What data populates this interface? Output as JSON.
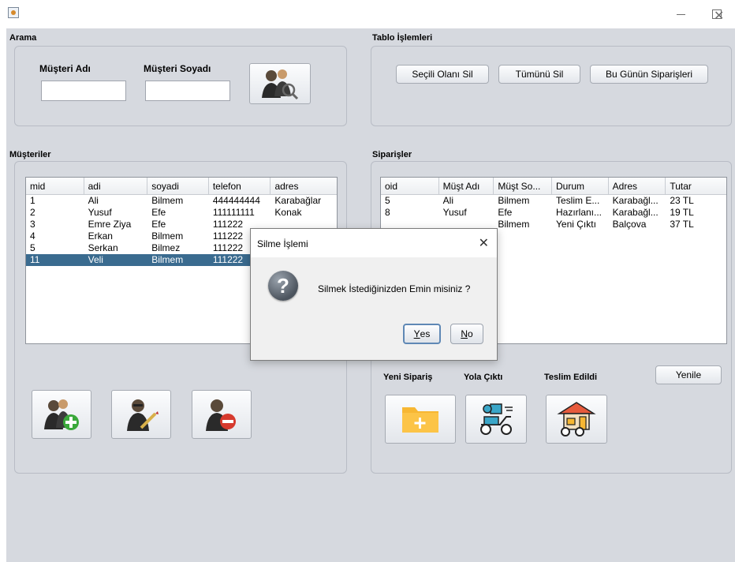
{
  "window": {
    "title": ""
  },
  "search": {
    "title": "Arama",
    "first_name_label": "Müşteri Adı",
    "last_name_label": "Müşteri Soyadı",
    "first_name_value": "",
    "last_name_value": ""
  },
  "table_ops": {
    "title": "Tablo İşlemleri",
    "delete_selected": "Seçili Olanı Sil",
    "delete_all": "Tümünü Sil",
    "today_orders": "Bu Günün Siparişleri"
  },
  "customers": {
    "title": "Müşteriler",
    "columns": [
      "mid",
      "adi",
      "soyadi",
      "telefon",
      "adres"
    ],
    "rows": [
      [
        "1",
        "Ali",
        "Bilmem",
        "444444444",
        "Karabağlar"
      ],
      [
        "2",
        "Yusuf",
        "Efe",
        "111111111",
        "Konak"
      ],
      [
        "3",
        "Emre Ziya",
        "Efe",
        "111222",
        ""
      ],
      [
        "4",
        "Erkan",
        "Bilmem",
        "111222",
        ""
      ],
      [
        "5",
        "Serkan",
        "Bilmez",
        "111222",
        ""
      ],
      [
        "11",
        "Veli",
        "Bilmem",
        "111222",
        ""
      ]
    ],
    "selected_row_index": 5
  },
  "orders": {
    "title": "Siparişler",
    "columns": [
      "oid",
      "Müşt Adı",
      "Müşt So...",
      "Durum",
      "Adres",
      "Tutar"
    ],
    "rows": [
      [
        "5",
        "Ali",
        "Bilmem",
        "Teslim E...",
        "Karabağl...",
        "23 TL"
      ],
      [
        "8",
        "Yusuf",
        "Efe",
        "Hazırlanı...",
        "Karabağl...",
        "19 TL"
      ],
      [
        "",
        "",
        "Bilmem",
        "Yeni Çıktı",
        "Balçova",
        "37 TL"
      ]
    ],
    "new_order_label": "Yeni Sipariş",
    "on_the_way_label": "Yola Çıktı",
    "delivered_label": "Teslim Edildi",
    "refresh": "Yenile"
  },
  "dialog": {
    "title": "Silme İşlemi",
    "message": "Silmek İstediğinizden Emin misiniz ?",
    "yes_mnemonic": "Y",
    "yes_rest": "es",
    "no_mnemonic": "N",
    "no_rest": "o"
  },
  "colors": {
    "panel_bg": "#d6d9df",
    "selection": "#3a6b8f",
    "folder": "#f7b733"
  }
}
